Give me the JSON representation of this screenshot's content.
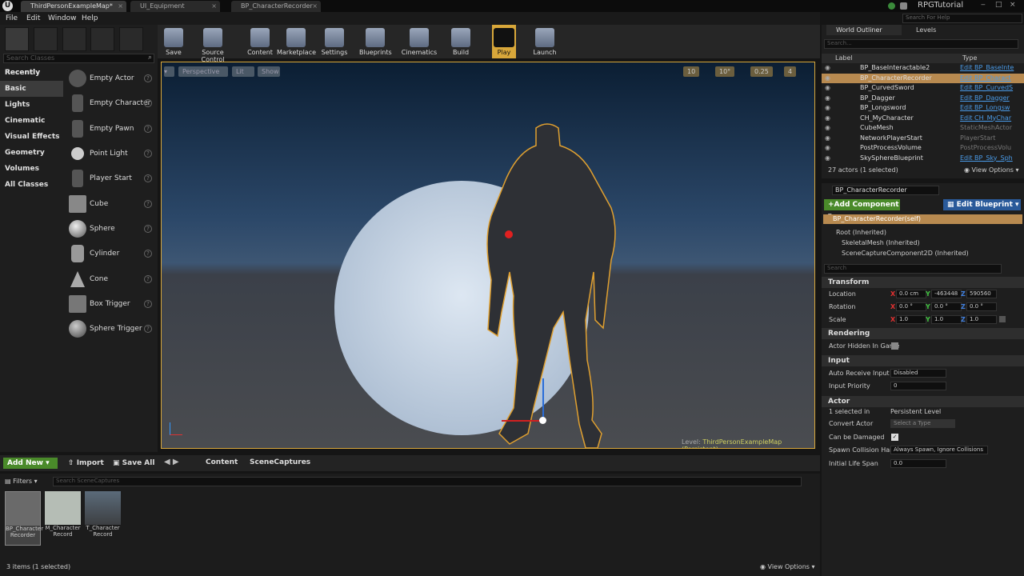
{
  "tabs": [
    "ThirdPersonExampleMap*",
    "UI_Equipment",
    "BP_CharacterRecorder"
  ],
  "project": "RPGTutorial",
  "help_search": {
    "placeholder": "Search For Help"
  },
  "menu": [
    "File",
    "Edit",
    "Window",
    "Help"
  ],
  "modes": {
    "search_placeholder": "Search Classes",
    "categories": [
      "Recently Placed",
      "Basic",
      "Lights",
      "Cinematic",
      "Visual Effects",
      "Geometry",
      "Volumes",
      "All Classes"
    ],
    "items": [
      "Empty Actor",
      "Empty Character",
      "Empty Pawn",
      "Point Light",
      "Player Start",
      "Cube",
      "Sphere",
      "Cylinder",
      "Cone",
      "Box Trigger",
      "Sphere Trigger"
    ],
    "help": "?"
  },
  "toolbar": [
    "Save",
    "Source Control",
    "Content",
    "Marketplace",
    "Settings",
    "Blueprints",
    "Cinematics",
    "Build",
    "Play",
    "Launch"
  ],
  "viewport": {
    "perspective": "Perspective",
    "lit": "Lit",
    "show": "Show",
    "snap_values": [
      "10",
      "10°",
      "0.25",
      "4"
    ],
    "level_label": "Level:",
    "level_name": "ThirdPersonExampleMap (Persistent)"
  },
  "content": {
    "add_new": "Add New",
    "import": "Import",
    "save_all": "Save All",
    "path": [
      "Content",
      "SceneCaptures"
    ],
    "filters": "Filters",
    "search_placeholder": "Search SceneCaptures",
    "assets": [
      "BP_Character Recorder",
      "M_Character Record",
      "T_Character Record"
    ],
    "status": "3 items (1 selected)",
    "view_options": "View Options"
  },
  "outliner": {
    "tabs": [
      "World Outliner",
      "Levels"
    ],
    "search_placeholder": "Search...",
    "col_label": "Label",
    "col_type": "Type",
    "rows": [
      {
        "name": "BP_BaseInteractable2",
        "type": "Edit BP_BaseInte",
        "link": true
      },
      {
        "name": "BP_CharacterRecorder",
        "type": "Edit BP_Charact",
        "link": true
      },
      {
        "name": "BP_CurvedSword",
        "type": "Edit BP_CurvedS",
        "link": true
      },
      {
        "name": "BP_Dagger",
        "type": "Edit BP_Dagger",
        "link": true
      },
      {
        "name": "BP_Longsword",
        "type": "Edit BP_Longsw",
        "link": true
      },
      {
        "name": "CH_MyCharacter",
        "type": "Edit CH_MyChar",
        "link": true
      },
      {
        "name": "CubeMesh",
        "type": "StaticMeshActor",
        "link": false
      },
      {
        "name": "NetworkPlayerStart",
        "type": "PlayerStart",
        "link": false
      },
      {
        "name": "PostProcessVolume",
        "type": "PostProcessVolu",
        "link": false
      },
      {
        "name": "SkySphereBlueprint",
        "type": "Edit BP_Sky_Sph",
        "link": true
      }
    ],
    "status": "27 actors (1 selected)",
    "view_options": "View Options"
  },
  "details": {
    "name": "BP_CharacterRecorder",
    "add_component": "Add Component",
    "edit_blueprint": "Edit Blueprint",
    "components": [
      "BP_CharacterRecorder(self)",
      "Root (Inherited)",
      "SkeletalMesh (Inherited)",
      "SceneCaptureComponent2D (Inherited)"
    ],
    "search_placeholder": "Search",
    "sections": {
      "transform": "Transform",
      "rendering": "Rendering",
      "input": "Input",
      "actor": "Actor"
    },
    "location": {
      "label": "Location",
      "x": "0.0 cm",
      "y": "-463448",
      "z": "590560"
    },
    "rotation": {
      "label": "Rotation",
      "x": "0.0 °",
      "y": "0.0 °",
      "z": "0.0 °"
    },
    "scale": {
      "label": "Scale",
      "x": "1.0",
      "y": "1.0",
      "z": "1.0"
    },
    "actor_hidden": "Actor Hidden In Game",
    "auto_receive": {
      "label": "Auto Receive Input",
      "value": "Disabled"
    },
    "input_priority": {
      "label": "Input Priority",
      "value": "0"
    },
    "selected_in": {
      "label": "1 selected in",
      "value": "Persistent Level"
    },
    "convert_actor": {
      "label": "Convert Actor",
      "value": "Select a Type"
    },
    "can_be_damaged": "Can be Damaged",
    "spawn_collision": {
      "label": "Spawn Collision Hand",
      "value": "Always Spawn, Ignore Collisions"
    },
    "initial_life": {
      "label": "Initial Life Span",
      "value": "0.0"
    }
  }
}
